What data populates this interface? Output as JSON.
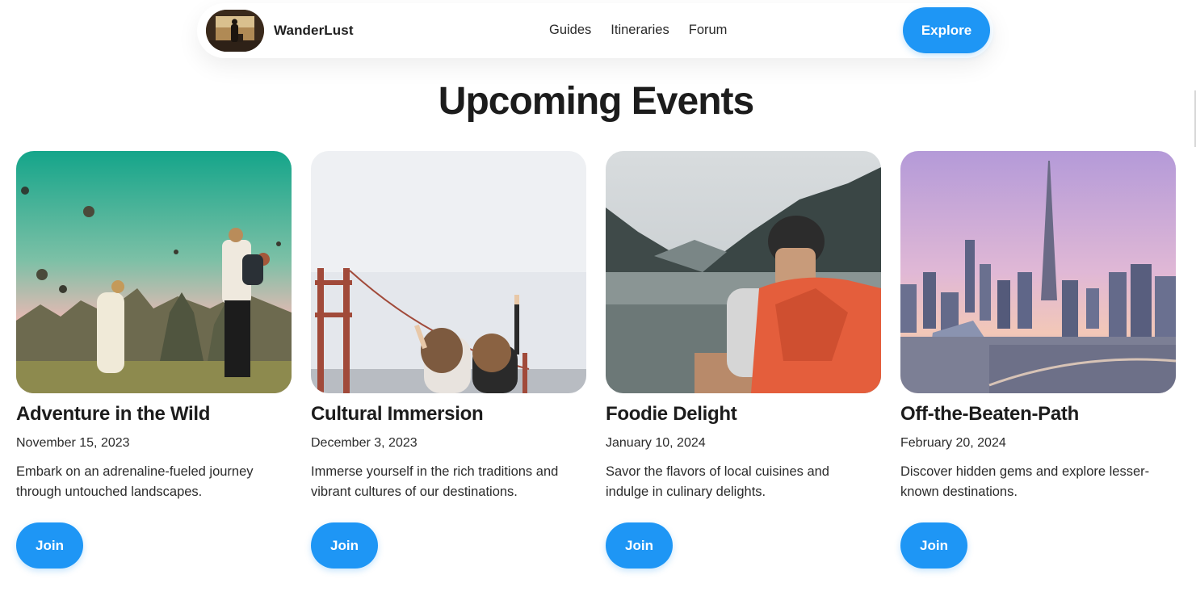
{
  "nav": {
    "brand": "WanderLust",
    "links": [
      {
        "label": "Guides"
      },
      {
        "label": "Itineraries"
      },
      {
        "label": "Forum"
      }
    ],
    "cta_label": "Explore"
  },
  "page": {
    "title": "Upcoming Events"
  },
  "events": [
    {
      "title": "Adventure in the Wild",
      "date": "November 15, 2023",
      "description": "Embark on an adrenaline-fueled journey through untouched landscapes.",
      "button_label": "Join"
    },
    {
      "title": "Cultural Immersion",
      "date": "December 3, 2023",
      "description": "Immerse yourself in the rich traditions and vibrant cultures of our destinations.",
      "button_label": "Join"
    },
    {
      "title": "Foodie Delight",
      "date": "January 10, 2024",
      "description": "Savor the flavors of local cuisines and indulge in culinary delights.",
      "button_label": "Join"
    },
    {
      "title": "Off-the-Beaten-Path",
      "date": "February 20, 2024",
      "description": "Discover hidden gems and explore lesser-known destinations.",
      "button_label": "Join"
    }
  ],
  "colors": {
    "accent": "#1e96f5",
    "text": "#1c1c1c",
    "background": "#ffffff"
  }
}
